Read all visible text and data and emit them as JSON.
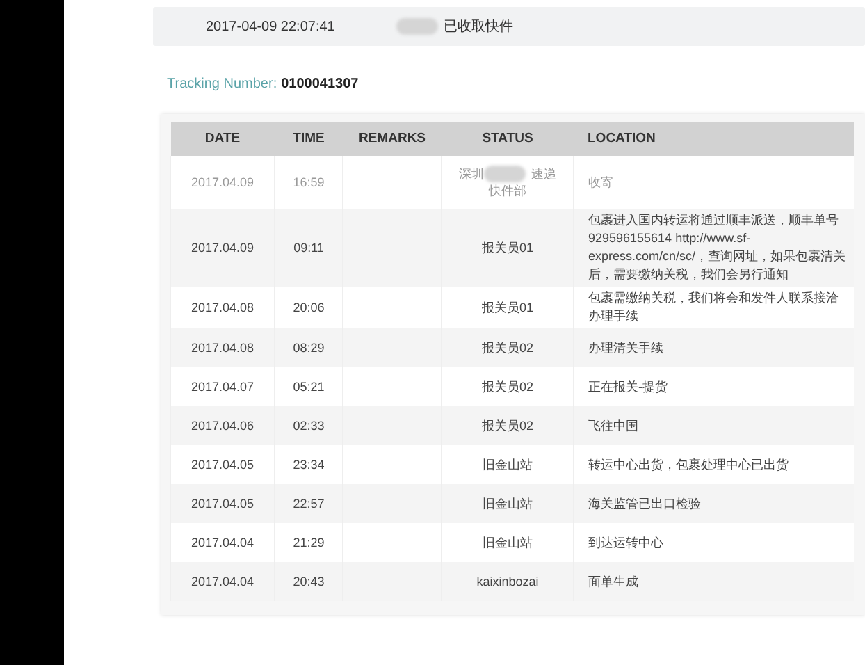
{
  "latest_event": {
    "time": "2017-04-09 22:07:41",
    "redacted": true,
    "text": "已收取快件"
  },
  "tracking": {
    "label": "Tracking Number:",
    "number": "0100041307"
  },
  "table": {
    "columns": [
      "DATE",
      "TIME",
      "REMARKS",
      "STATUS",
      "LOCATION"
    ],
    "rows": [
      {
        "date": "2017.04.09",
        "time": "16:59",
        "status": "深圳",
        "redacted": true,
        "status_after": "速递",
        "status_line2": "快件部",
        "location": "收寄",
        "faded": true
      },
      {
        "date": "2017.04.09",
        "time": "09:11",
        "status": "报关员01",
        "location": "包裹进入国内转运将通过顺丰派送，顺丰单号929596155614 http://www.sf-express.com/cn/sc/，查询网址，如果包裹清关后，需要缴纳关税，我们会另行通知",
        "faded": false
      },
      {
        "date": "2017.04.08",
        "time": "20:06",
        "status": "报关员01",
        "location": "包裹需缴纳关税，我们将会和发件人联系接洽办理手续",
        "faded": false
      },
      {
        "date": "2017.04.08",
        "time": "08:29",
        "status": "报关员02",
        "location": "办理清关手续",
        "faded": false
      },
      {
        "date": "2017.04.07",
        "time": "05:21",
        "status": "报关员02",
        "location": "正在报关-提货",
        "faded": false
      },
      {
        "date": "2017.04.06",
        "time": "02:33",
        "status": "报关员02",
        "location": "飞往中国",
        "faded": false
      },
      {
        "date": "2017.04.05",
        "time": "23:34",
        "status": "旧金山站",
        "location": "转运中心出货，包裹处理中心已出货",
        "faded": false
      },
      {
        "date": "2017.04.05",
        "time": "22:57",
        "status": "旧金山站",
        "location": "海关监管已出口检验",
        "faded": false
      },
      {
        "date": "2017.04.04",
        "time": "21:29",
        "status": "旧金山站",
        "location": "到达运转中心",
        "faded": false
      },
      {
        "date": "2017.04.04",
        "time": "20:43",
        "status": "kaixinbozai",
        "location": "面单生成",
        "faded": false
      }
    ]
  }
}
